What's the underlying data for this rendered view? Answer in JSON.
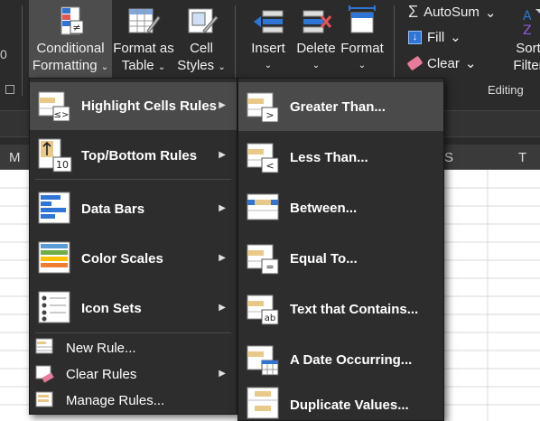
{
  "ribbon": {
    "left_edge_label": "0",
    "conditional_formatting": {
      "line1": "Conditional",
      "line2": "Formatting"
    },
    "format_as_table": {
      "line1": "Format as",
      "line2": "Table"
    },
    "cell_styles": {
      "line1": "Cell",
      "line2": "Styles"
    },
    "insert": "Insert",
    "delete": "Delete",
    "format": "Format",
    "autosum": "AutoSum",
    "fill": "Fill",
    "clear": "Clear",
    "sort_filter": {
      "line1": "Sort",
      "line2": "Filter"
    },
    "editing_group_label": "Editing",
    "chevron": "⌄"
  },
  "columns": [
    "M",
    "S",
    "T"
  ],
  "menu": {
    "items": [
      {
        "label": "Highlight Cells Rules"
      },
      {
        "label": "Top/Bottom Rules"
      },
      {
        "label": "Data Bars"
      },
      {
        "label": "Color Scales"
      },
      {
        "label": "Icon Sets"
      },
      {
        "label": "New Rule..."
      },
      {
        "label": "Clear Rules"
      },
      {
        "label": "Manage Rules..."
      }
    ]
  },
  "submenu": {
    "items": [
      {
        "label": "Greater Than..."
      },
      {
        "label": "Less Than..."
      },
      {
        "label": "Between..."
      },
      {
        "label": "Equal To..."
      },
      {
        "label": "Text that Contains..."
      },
      {
        "label": "A Date Occurring..."
      },
      {
        "label": "Duplicate Values..."
      }
    ]
  },
  "icon_text": {
    "top_bottom": "10",
    "greater": ">",
    "less": "<",
    "equal": "=",
    "text_contains": "ab",
    "highlight_small": "≤>",
    "cf_symbol": "≠"
  },
  "colors": {
    "accent_gold": "#e8c98a",
    "cell_blue": "#2e75d6",
    "menu_bg": "#2d2d2d",
    "highlight_bg": "#4a4a4a"
  }
}
